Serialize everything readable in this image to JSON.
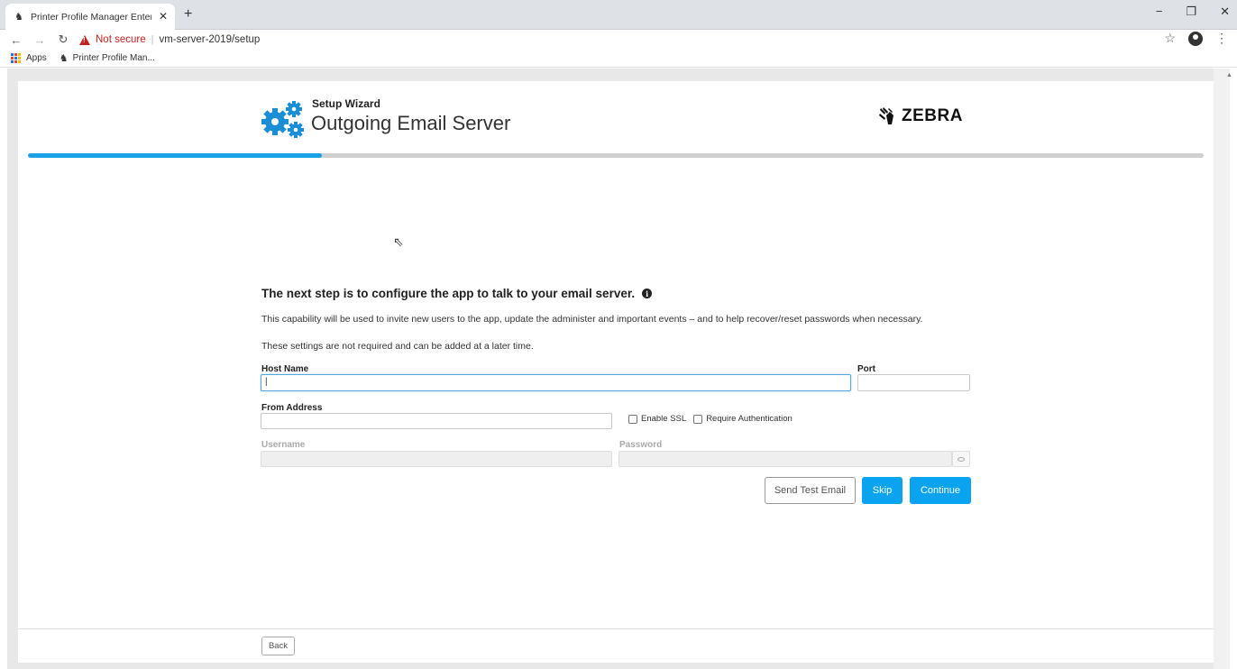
{
  "browser": {
    "tab_title": "Printer Profile Manager Enterprise",
    "tab_favicon": "zebra-favicon",
    "new_tab_label": "+",
    "not_secure_label": "Not secure",
    "url": "vm-server-2019/setup",
    "bookmarks": [
      {
        "label": "Apps",
        "icon": "apps-grid-icon"
      },
      {
        "label": "Printer Profile Man...",
        "icon": "zebra-favicon"
      }
    ]
  },
  "header": {
    "wizard_label": "Setup Wizard",
    "title": "Outgoing Email Server",
    "logo_text": "ZEBRA",
    "progress": 0.25
  },
  "form": {
    "heading": "The next step is to configure the app to talk to your email server.",
    "description": "This capability will be used to invite new users to the app, update the administer and important events – and to help recover/reset passwords when necessary.",
    "note": "These settings are not required and can be added at a later time.",
    "host_name": {
      "label": "Host Name",
      "value": "|"
    },
    "port": {
      "label": "Port",
      "value": ""
    },
    "from_address": {
      "label": "From Address",
      "value": ""
    },
    "enable_ssl": {
      "label": "Enable SSL",
      "checked": false
    },
    "require_auth": {
      "label": "Require Authentication",
      "checked": false
    },
    "username": {
      "label": "Username",
      "value": ""
    },
    "password": {
      "label": "Password",
      "value": ""
    }
  },
  "actions": {
    "send_test_email": "Send Test Email",
    "skip": "Skip",
    "continue": "Continue",
    "back": "Back"
  },
  "colors": {
    "accent": "#0aa3ef",
    "progress": "#1da1e6",
    "not_secure": "#c5221f"
  }
}
